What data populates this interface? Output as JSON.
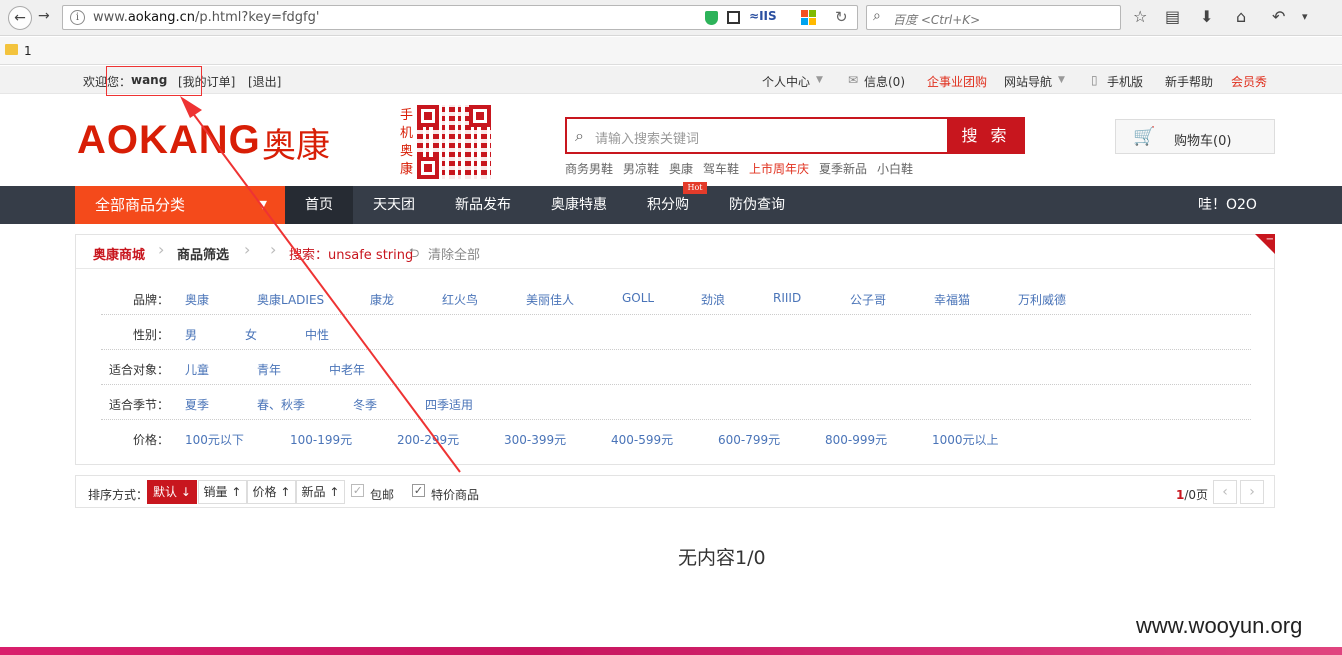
{
  "browser": {
    "url_prefix": "www.",
    "url_domain": "aokang.cn",
    "url_path": "/p.html?key=fdgfg'",
    "iis_label": "IIS",
    "search_placeholder": "百度 <Ctrl+K>",
    "bookmark": "1"
  },
  "topbar": {
    "welcome": "欢迎您：",
    "username": "wang",
    "my_orders": "[我的订单]",
    "logout": "[退出]",
    "personal_center": "个人中心",
    "messages": "信息(0)",
    "enterprise": "企事业团购",
    "site_nav": "网站导航",
    "mobile": "手机版",
    "help": "新手帮助",
    "member_show": "会员秀",
    "colors": {
      "red": "#e0301e"
    }
  },
  "header": {
    "logo_en": "AOKANG",
    "logo_cn": "奥康",
    "mobile_vertical": "手机奥康",
    "search_placeholder": "请输入搜索关键词",
    "search_button": "搜 索",
    "hotwords": [
      "商务男鞋",
      "男凉鞋",
      "奥康",
      "驾车鞋",
      "上市周年庆",
      "夏季新品",
      "小白鞋"
    ],
    "cart_label": "购物车(0)"
  },
  "nav": {
    "all_categories": "全部商品分类",
    "items": [
      "首页",
      "天天团",
      "新品发布",
      "奥康特惠",
      "积分购",
      "防伪查询"
    ],
    "hot_badge": "Hot",
    "right": "哇！O2O"
  },
  "breadcrumb": {
    "mall": "奥康商城",
    "filter": "商品筛选",
    "search": "搜索：unsafe string",
    "clear": "清除全部"
  },
  "filters": [
    {
      "label": "品牌：",
      "options": [
        "奥康",
        "奥康LADIES",
        "康龙",
        "红火鸟",
        "美丽佳人",
        "GOLL",
        "劲浪",
        "RIIID",
        "公子哥",
        "幸福猫",
        "万利威德"
      ]
    },
    {
      "label": "性别：",
      "options": [
        "男",
        "女",
        "中性"
      ]
    },
    {
      "label": "适合对象：",
      "options": [
        "儿童",
        "青年",
        "中老年"
      ]
    },
    {
      "label": "适合季节：",
      "options": [
        "夏季",
        "春、秋季",
        "冬季",
        "四季适用"
      ]
    },
    {
      "label": "价格：",
      "options": [
        "100元以下",
        "100-199元",
        "200-299元",
        "300-399元",
        "400-599元",
        "600-799元",
        "800-999元",
        "1000元以上"
      ]
    }
  ],
  "sort": {
    "label": "排序方式：",
    "default": "默认",
    "sales": "销量",
    "price": "价格",
    "new": "新品",
    "free_shipping": "包邮",
    "special_offer": "特价商品",
    "page_current": "1",
    "page_total": "/0页"
  },
  "empty_text": "无内容1/0",
  "watermark": "www.wooyun.org"
}
